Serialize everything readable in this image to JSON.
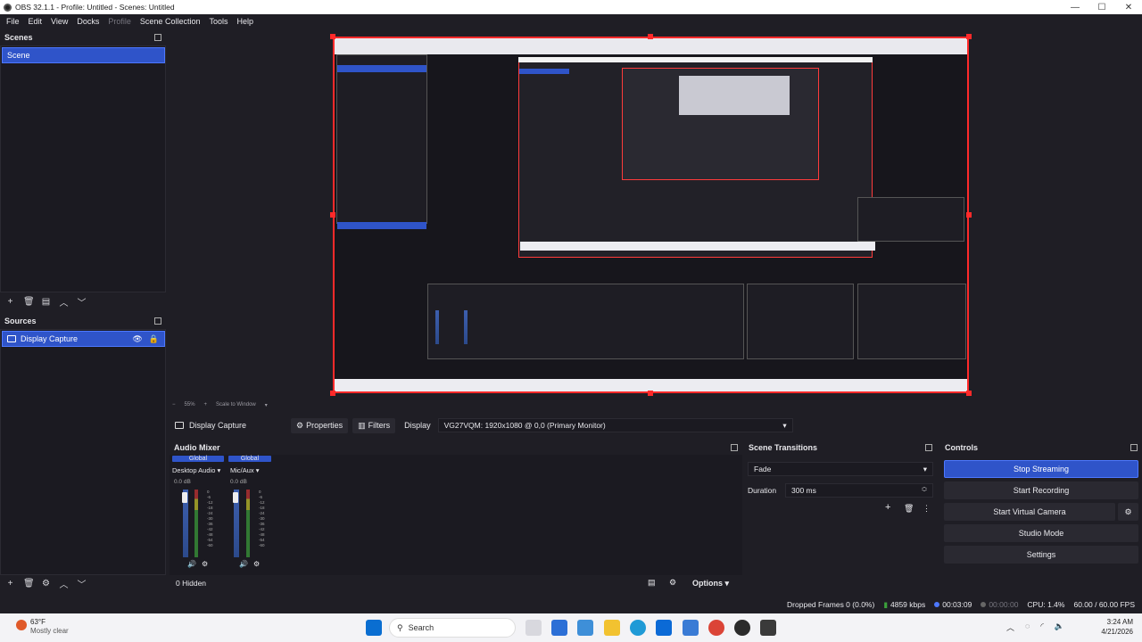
{
  "window": {
    "title": "OBS 32.1.1 - Profile: Untitled - Scenes: Untitled"
  },
  "menu": [
    "File",
    "Edit",
    "View",
    "Docks",
    "Profile",
    "Scene Collection",
    "Tools",
    "Help"
  ],
  "scenes": {
    "header": "Scenes",
    "items": [
      "Scene"
    ]
  },
  "sources": {
    "header": "Sources",
    "items": [
      {
        "label": "Display Capture"
      }
    ]
  },
  "preview": {
    "zoom": "55%",
    "scale_mode": "Scale to Window"
  },
  "context_bar": {
    "source_name": "Display Capture",
    "properties_label": "Properties",
    "filters_label": "Filters",
    "display_label": "Display",
    "display_value": "VG27VQM: 1920x1080 @ 0,0 (Primary Monitor)"
  },
  "audio_mixer": {
    "header": "Audio Mixer",
    "channels": [
      {
        "tag": "Global",
        "name": "Desktop Audio",
        "db": "0.0 dB"
      },
      {
        "tag": "Global",
        "name": "Mic/Aux",
        "db": "0.0 dB"
      }
    ],
    "scale": [
      "0",
      "-6",
      "-12",
      "-18",
      "-24",
      "-30",
      "-36",
      "-42",
      "-48",
      "-54",
      "-60"
    ],
    "hidden_label": "0 Hidden",
    "options_label": "Options"
  },
  "scene_transitions": {
    "header": "Scene Transitions",
    "transition": "Fade",
    "duration_label": "Duration",
    "duration_value": "300 ms"
  },
  "controls": {
    "header": "Controls",
    "buttons": [
      "Stop Streaming",
      "Start Recording",
      "Start Virtual Camera",
      "Studio Mode",
      "Settings"
    ]
  },
  "status": {
    "dropped_frames": "Dropped Frames 0 (0.0%)",
    "bitrate": "4859 kbps",
    "stream_time": "00:03:09",
    "rec_time": "00:00:00",
    "cpu": "CPU: 1.4%",
    "fps": "60.00 / 60.00 FPS"
  },
  "taskbar": {
    "weather_temp": "63°F",
    "weather_desc": "Mostly clear",
    "search_placeholder": "Search",
    "time": "3:24 AM",
    "date": "4/21/2026"
  },
  "colors": {
    "accent": "#2f54c9",
    "preview_border": "#ff2a2a",
    "background": "#1f1e25"
  }
}
